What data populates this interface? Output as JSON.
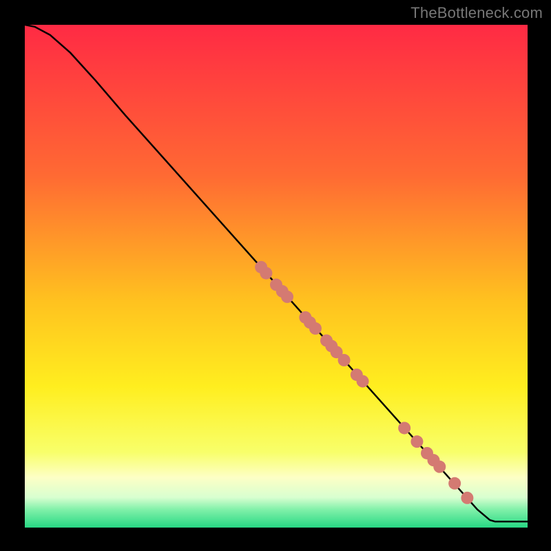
{
  "watermark": "TheBottleneck.com",
  "chart_data": {
    "type": "line",
    "title": "",
    "xlabel": "",
    "ylabel": "",
    "xlim": [
      0,
      100
    ],
    "ylim": [
      0,
      100
    ],
    "gradient_stops": [
      {
        "offset": 0.0,
        "color": "#ff2a44"
      },
      {
        "offset": 0.3,
        "color": "#ff6a33"
      },
      {
        "offset": 0.55,
        "color": "#ffc21f"
      },
      {
        "offset": 0.72,
        "color": "#ffee1f"
      },
      {
        "offset": 0.85,
        "color": "#f8ff6a"
      },
      {
        "offset": 0.9,
        "color": "#fdffc5"
      },
      {
        "offset": 0.94,
        "color": "#d8ffd0"
      },
      {
        "offset": 0.965,
        "color": "#7ef0a8"
      },
      {
        "offset": 1.0,
        "color": "#27d884"
      }
    ],
    "curve": [
      {
        "x": 0,
        "y": 100.0
      },
      {
        "x": 2,
        "y": 99.6
      },
      {
        "x": 5,
        "y": 98.0
      },
      {
        "x": 9,
        "y": 94.5
      },
      {
        "x": 14,
        "y": 89.0
      },
      {
        "x": 20,
        "y": 82.0
      },
      {
        "x": 30,
        "y": 70.8
      },
      {
        "x": 40,
        "y": 59.6
      },
      {
        "x": 50,
        "y": 48.4
      },
      {
        "x": 60,
        "y": 37.2
      },
      {
        "x": 70,
        "y": 26.0
      },
      {
        "x": 80,
        "y": 14.8
      },
      {
        "x": 90,
        "y": 3.6
      },
      {
        "x": 92.5,
        "y": 1.5
      },
      {
        "x": 93.5,
        "y": 1.2
      },
      {
        "x": 100,
        "y": 1.2
      }
    ],
    "markers": [
      {
        "x": 47.0,
        "y": 51.8
      },
      {
        "x": 48.0,
        "y": 50.6
      },
      {
        "x": 50.0,
        "y": 48.3
      },
      {
        "x": 51.2,
        "y": 47.0
      },
      {
        "x": 52.2,
        "y": 45.9
      },
      {
        "x": 55.8,
        "y": 41.8
      },
      {
        "x": 56.7,
        "y": 40.8
      },
      {
        "x": 57.8,
        "y": 39.6
      },
      {
        "x": 60.0,
        "y": 37.2
      },
      {
        "x": 61.0,
        "y": 36.1
      },
      {
        "x": 62.0,
        "y": 34.9
      },
      {
        "x": 63.5,
        "y": 33.3
      },
      {
        "x": 66.0,
        "y": 30.4
      },
      {
        "x": 67.2,
        "y": 29.1
      },
      {
        "x": 75.5,
        "y": 19.8
      },
      {
        "x": 78.0,
        "y": 17.1
      },
      {
        "x": 80.0,
        "y": 14.8
      },
      {
        "x": 81.3,
        "y": 13.4
      },
      {
        "x": 82.5,
        "y": 12.1
      },
      {
        "x": 85.5,
        "y": 8.8
      },
      {
        "x": 88.0,
        "y": 5.9
      }
    ],
    "marker_color": "#d47a72",
    "marker_radius": 9
  }
}
